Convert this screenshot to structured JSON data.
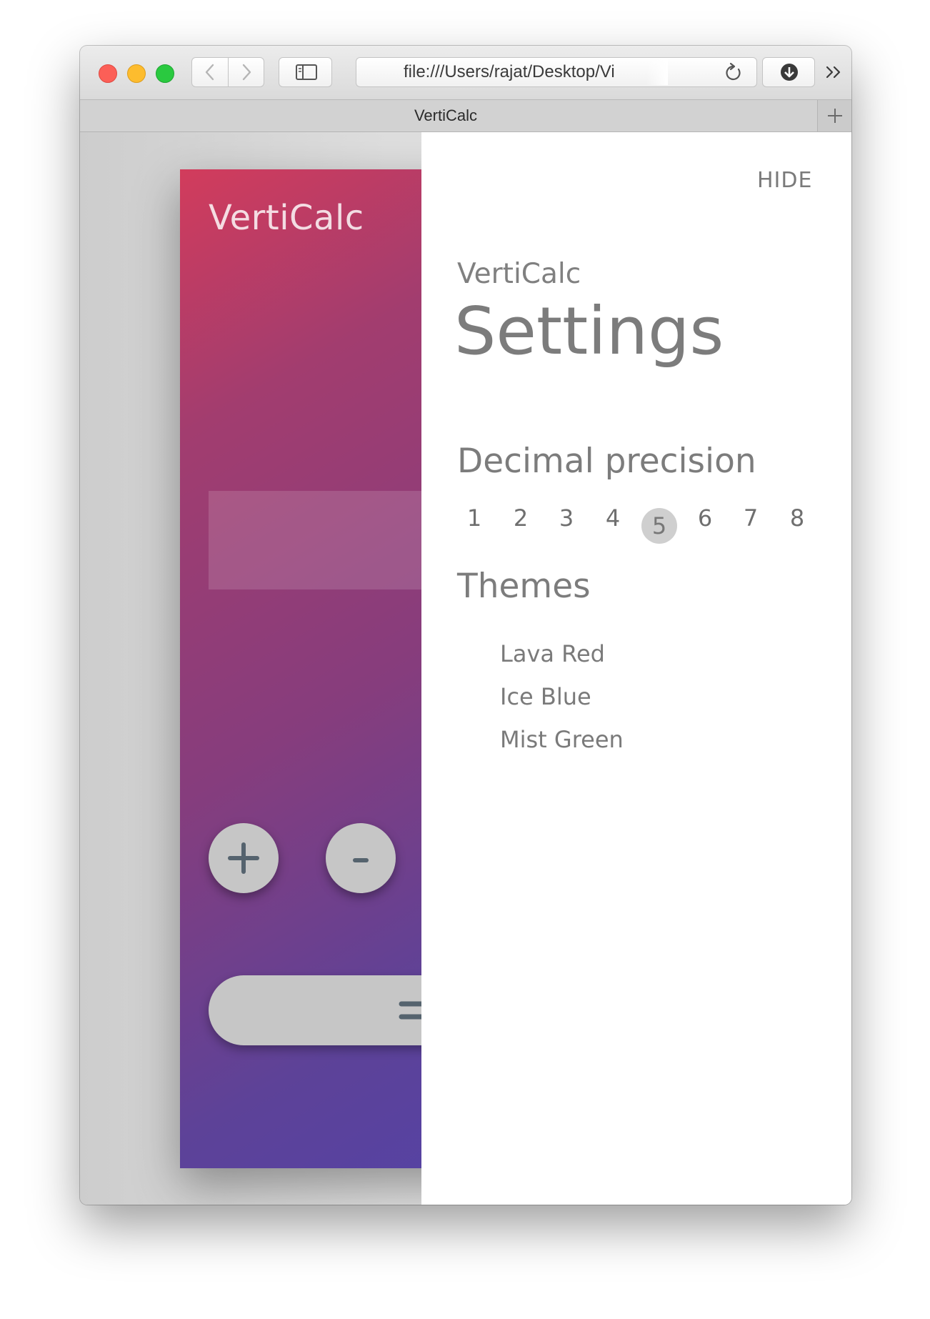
{
  "browser": {
    "url": "file:///Users/rajat/Desktop/Vi",
    "tab_title": "VertiCalc"
  },
  "app": {
    "title": "VertiCalc",
    "plus_label": "+",
    "minus_label": "-",
    "equals_label": "=",
    "gradient_colors": [
      "#d23c5c",
      "#863d7d",
      "#5443a6"
    ]
  },
  "settings": {
    "hide_label": "HIDE",
    "app_name": "VertiCalc",
    "heading": "Settings",
    "precision_heading": "Decimal precision",
    "precision_options": [
      "1",
      "2",
      "3",
      "4",
      "5",
      "6",
      "7",
      "8"
    ],
    "precision_selected": "5",
    "themes_heading": "Themes",
    "themes": [
      "Lava Red",
      "Ice Blue",
      "Mist Green"
    ]
  },
  "icons": {
    "window_controls": [
      "close-icon",
      "minimize-icon",
      "zoom-icon"
    ],
    "toolbar": [
      "back-icon",
      "forward-icon",
      "sidebar-icon",
      "reload-icon",
      "download-icon",
      "overflow-chevrons-icon"
    ],
    "tabbar": [
      "new-tab-plus-icon"
    ]
  }
}
